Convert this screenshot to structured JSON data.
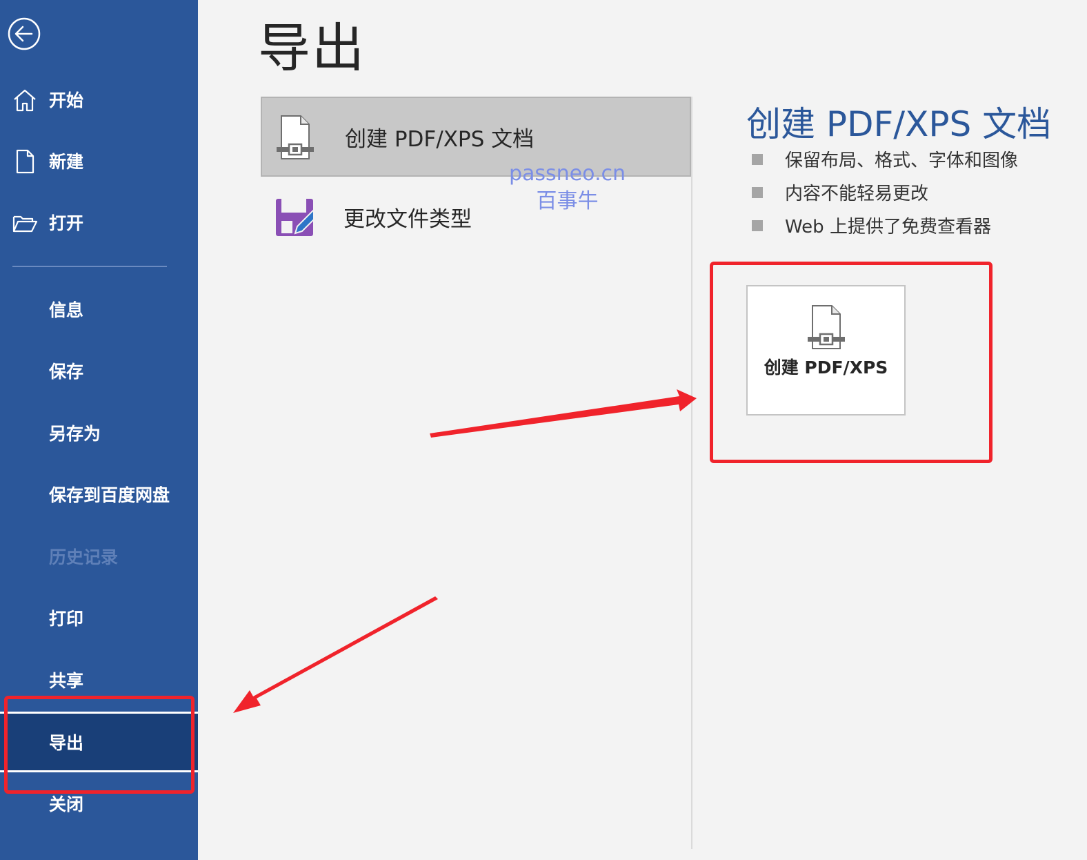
{
  "sidebar": {
    "items": [
      {
        "label": "开始",
        "icon": "home-icon"
      },
      {
        "label": "新建",
        "icon": "new-document-icon"
      },
      {
        "label": "打开",
        "icon": "open-folder-icon"
      },
      {
        "label": "信息"
      },
      {
        "label": "保存"
      },
      {
        "label": "另存为"
      },
      {
        "label": "保存到百度网盘"
      },
      {
        "label": "历史记录",
        "disabled": true
      },
      {
        "label": "打印"
      },
      {
        "label": "共享"
      },
      {
        "label": "导出",
        "active": true
      },
      {
        "label": "关闭"
      }
    ]
  },
  "main": {
    "title": "导出",
    "export_options": [
      {
        "label": "创建 PDF/XPS 文档",
        "icon": "pdf-document-icon",
        "selected": true
      },
      {
        "label": "更改文件类型",
        "icon": "change-file-type-icon"
      }
    ]
  },
  "watermark": {
    "line1": "passneo.cn",
    "line2": "百事牛"
  },
  "detail": {
    "title": "创建 PDF/XPS 文档",
    "bullets": [
      "保留布局、格式、字体和图像",
      "内容不能轻易更改",
      "Web 上提供了免费查看器"
    ],
    "button_label": "创建 PDF/XPS"
  },
  "colors": {
    "sidebar_bg": "#2b579a",
    "sidebar_active": "#193f78",
    "accent": "#2b579a",
    "annotation_red": "#f0232b"
  }
}
